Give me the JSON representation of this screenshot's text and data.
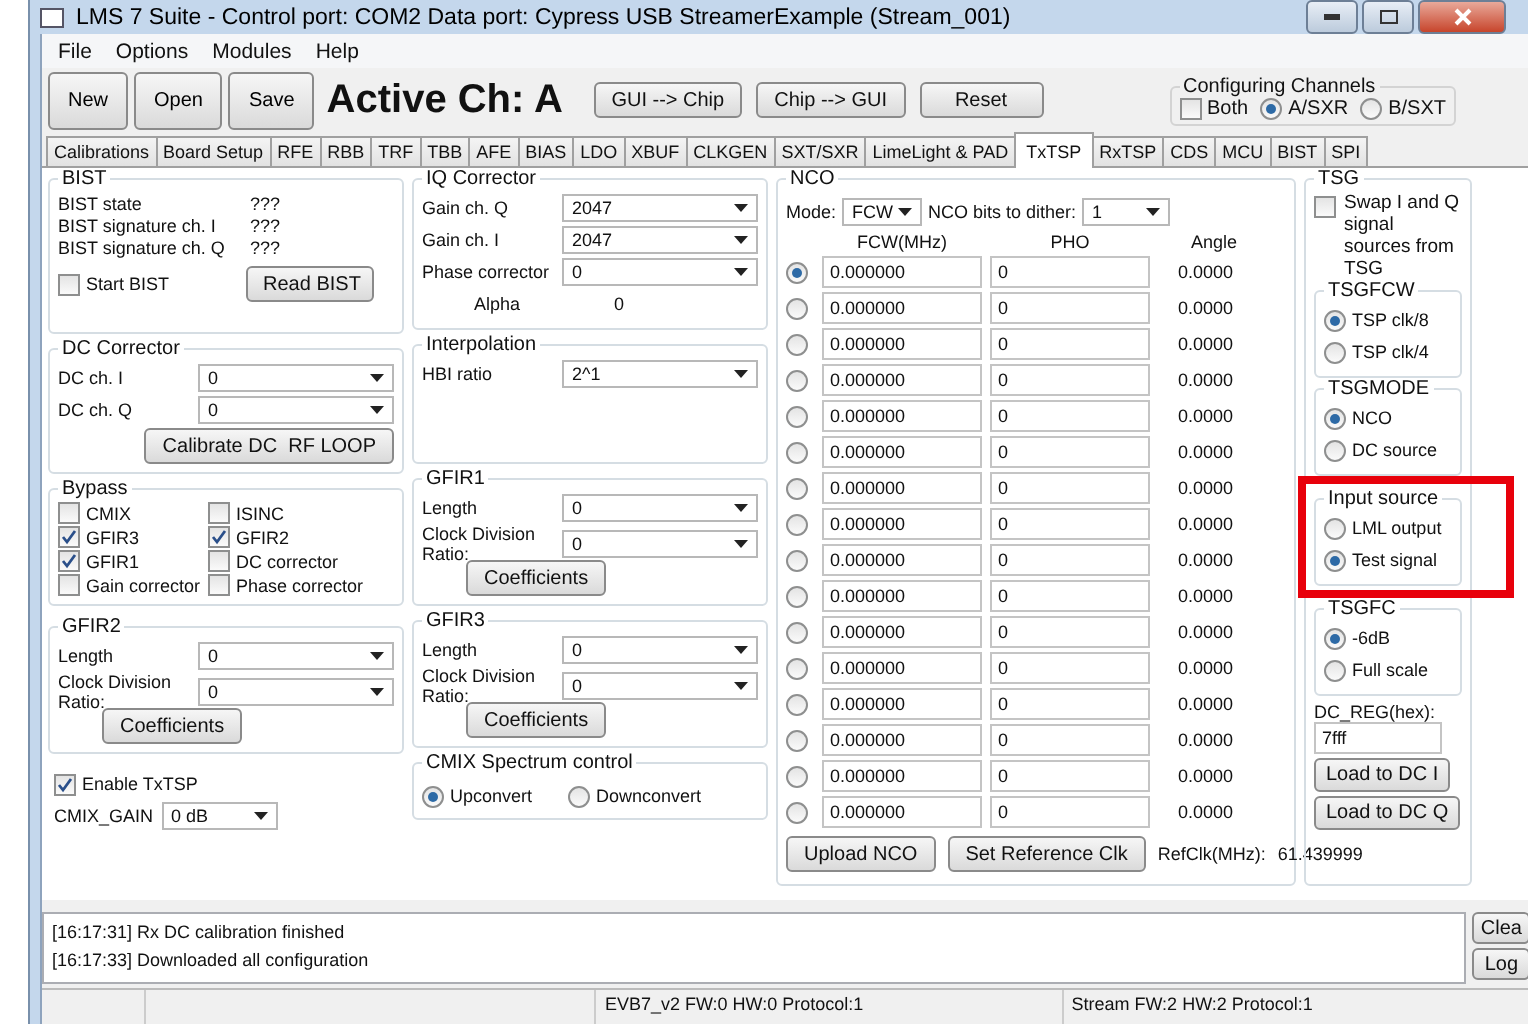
{
  "window": {
    "title": "LMS 7 Suite - Control port: COM2 Data port: Cypress USB StreamerExample (Stream_001)"
  },
  "menu": [
    "File",
    "Options",
    "Modules",
    "Help"
  ],
  "toolbar": {
    "buttons": [
      "New",
      "Open",
      "Save"
    ],
    "active_channel": "Active Ch: A",
    "actions": [
      "GUI --> Chip",
      "Chip --> GUI",
      "Reset"
    ],
    "configuring_channels": {
      "title": "Configuring Channels",
      "both": {
        "label": "Both",
        "checked": false
      },
      "options": [
        {
          "label": "A/SXR",
          "selected": true
        },
        {
          "label": "B/SXT",
          "selected": false
        }
      ]
    }
  },
  "tabs": [
    {
      "label": "Calibrations",
      "selected": false
    },
    {
      "label": "Board Setup",
      "selected": false
    },
    {
      "label": "RFE",
      "selected": false
    },
    {
      "label": "RBB",
      "selected": false
    },
    {
      "label": "TRF",
      "selected": false
    },
    {
      "label": "TBB",
      "selected": false
    },
    {
      "label": "AFE",
      "selected": false
    },
    {
      "label": "BIAS",
      "selected": false
    },
    {
      "label": "LDO",
      "selected": false
    },
    {
      "label": "XBUF",
      "selected": false
    },
    {
      "label": "CLKGEN",
      "selected": false
    },
    {
      "label": "SXT/SXR",
      "selected": false
    },
    {
      "label": "LimeLight & PAD",
      "selected": false
    },
    {
      "label": "TxTSP",
      "selected": true
    },
    {
      "label": "RxTSP",
      "selected": false
    },
    {
      "label": "CDS",
      "selected": false
    },
    {
      "label": "MCU",
      "selected": false
    },
    {
      "label": "BIST",
      "selected": false
    },
    {
      "label": "SPI",
      "selected": false
    }
  ],
  "bist": {
    "title": "BIST",
    "rows": [
      {
        "label": "BIST state",
        "value": "???"
      },
      {
        "label": "BIST signature ch. I",
        "value": "???"
      },
      {
        "label": "BIST signature ch. Q",
        "value": "???"
      }
    ],
    "start": {
      "label": "Start BIST",
      "checked": false
    },
    "button": "Read BIST"
  },
  "dc_corrector": {
    "title": "DC Corrector",
    "fields": [
      {
        "label": "DC ch. I",
        "value": "0"
      },
      {
        "label": "DC ch. Q",
        "value": "0"
      }
    ],
    "button": "Calibrate DC  RF LOOP"
  },
  "bypass": {
    "title": "Bypass",
    "items": [
      {
        "label": "CMIX",
        "checked": false
      },
      {
        "label": "ISINC",
        "checked": false
      },
      {
        "label": "GFIR3",
        "checked": true
      },
      {
        "label": "GFIR2",
        "checked": true
      },
      {
        "label": "GFIR1",
        "checked": true
      },
      {
        "label": "DC corrector",
        "checked": false
      },
      {
        "label": "Gain corrector",
        "checked": false
      },
      {
        "label": "Phase corrector",
        "checked": false
      }
    ]
  },
  "gfir2": {
    "title": "GFIR2",
    "fields": [
      {
        "label": "Length",
        "value": "0"
      },
      {
        "label": "Clock Division Ratio:",
        "value": "0"
      }
    ],
    "button": "Coefficients"
  },
  "enable_txtsp": {
    "label": "Enable TxTSP",
    "checked": true
  },
  "cmix_gain": {
    "label": "CMIX_GAIN",
    "value": "0 dB"
  },
  "iq_corrector": {
    "title": "IQ Corrector",
    "fields": [
      {
        "label": "Gain ch. Q",
        "value": "2047"
      },
      {
        "label": "Gain ch. I",
        "value": "2047"
      },
      {
        "label": "Phase corrector",
        "value": "0"
      }
    ],
    "alpha": {
      "label": "Alpha",
      "value": "0"
    }
  },
  "interpolation": {
    "title": "Interpolation",
    "fields": [
      {
        "label": "HBI ratio",
        "value": "2^1"
      }
    ]
  },
  "gfir1": {
    "title": "GFIR1",
    "fields": [
      {
        "label": "Length",
        "value": "0"
      },
      {
        "label": "Clock Division Ratio:",
        "value": "0"
      }
    ],
    "button": "Coefficients"
  },
  "gfir3": {
    "title": "GFIR3",
    "fields": [
      {
        "label": "Length",
        "value": "0"
      },
      {
        "label": "Clock Division Ratio:",
        "value": "0"
      }
    ],
    "button": "Coefficients"
  },
  "cmix_spectrum": {
    "title": "CMIX Spectrum control",
    "options": [
      {
        "label": "Upconvert",
        "selected": true
      },
      {
        "label": "Downconvert",
        "selected": false
      }
    ]
  },
  "nco": {
    "title": "NCO",
    "mode": {
      "label": "Mode:",
      "value": "FCW"
    },
    "dither": {
      "label": "NCO bits to dither:",
      "value": "1"
    },
    "columns": [
      "FCW(MHz)",
      "PHO",
      "Angle"
    ],
    "rows": [
      {
        "selected": true,
        "fcw": "0.000000",
        "pho": "0",
        "angle": "0.0000"
      },
      {
        "selected": false,
        "fcw": "0.000000",
        "pho": "0",
        "angle": "0.0000"
      },
      {
        "selected": false,
        "fcw": "0.000000",
        "pho": "0",
        "angle": "0.0000"
      },
      {
        "selected": false,
        "fcw": "0.000000",
        "pho": "0",
        "angle": "0.0000"
      },
      {
        "selected": false,
        "fcw": "0.000000",
        "pho": "0",
        "angle": "0.0000"
      },
      {
        "selected": false,
        "fcw": "0.000000",
        "pho": "0",
        "angle": "0.0000"
      },
      {
        "selected": false,
        "fcw": "0.000000",
        "pho": "0",
        "angle": "0.0000"
      },
      {
        "selected": false,
        "fcw": "0.000000",
        "pho": "0",
        "angle": "0.0000"
      },
      {
        "selected": false,
        "fcw": "0.000000",
        "pho": "0",
        "angle": "0.0000"
      },
      {
        "selected": false,
        "fcw": "0.000000",
        "pho": "0",
        "angle": "0.0000"
      },
      {
        "selected": false,
        "fcw": "0.000000",
        "pho": "0",
        "angle": "0.0000"
      },
      {
        "selected": false,
        "fcw": "0.000000",
        "pho": "0",
        "angle": "0.0000"
      },
      {
        "selected": false,
        "fcw": "0.000000",
        "pho": "0",
        "angle": "0.0000"
      },
      {
        "selected": false,
        "fcw": "0.000000",
        "pho": "0",
        "angle": "0.0000"
      },
      {
        "selected": false,
        "fcw": "0.000000",
        "pho": "0",
        "angle": "0.0000"
      },
      {
        "selected": false,
        "fcw": "0.000000",
        "pho": "0",
        "angle": "0.0000"
      }
    ],
    "buttons": [
      "Upload NCO",
      "Set Reference Clk"
    ],
    "refclk": {
      "label": "RefClk(MHz):",
      "value": "61.439999"
    }
  },
  "tsg": {
    "title": "TSG",
    "swap": {
      "label": "Swap I and Q signal sources from TSG",
      "checked": false
    },
    "groups": [
      {
        "title": "TSGFCW",
        "highlighted": false,
        "options": [
          {
            "label": "TSP clk/8",
            "selected": true
          },
          {
            "label": "TSP clk/4",
            "selected": false
          }
        ]
      },
      {
        "title": "TSGMODE",
        "highlighted": false,
        "options": [
          {
            "label": "NCO",
            "selected": true
          },
          {
            "label": "DC source",
            "selected": false
          }
        ]
      },
      {
        "title": "Input source",
        "highlighted": true,
        "options": [
          {
            "label": "LML output",
            "selected": false
          },
          {
            "label": "Test signal",
            "selected": true
          }
        ]
      },
      {
        "title": "TSGFC",
        "highlighted": false,
        "options": [
          {
            "label": "-6dB",
            "selected": true
          },
          {
            "label": "Full scale",
            "selected": false
          }
        ]
      }
    ],
    "dc_reg": {
      "label": "DC_REG(hex):",
      "value": "7fff"
    },
    "buttons": [
      "Load to DC I",
      "Load to DC Q"
    ]
  },
  "log": {
    "lines": [
      "[16:17:31] Rx DC calibration finished",
      "[16:17:33] Downloaded all configuration"
    ],
    "buttons": [
      "Clea",
      "Log"
    ]
  },
  "status_bar": {
    "cells": [
      "EVB7_v2  FW:0 HW:0 Protocol:1",
      "Stream  FW:2 HW:2 Protocol:1"
    ]
  }
}
